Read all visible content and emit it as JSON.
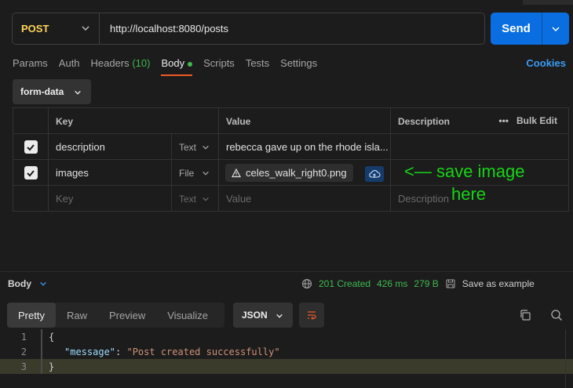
{
  "request": {
    "method": "POST",
    "url": "http://localhost:8080/posts",
    "send_label": "Send"
  },
  "tabs": [
    {
      "label": "Params"
    },
    {
      "label": "Auth"
    },
    {
      "label": "Headers",
      "count": "(10)"
    },
    {
      "label": "Body"
    },
    {
      "label": "Scripts"
    },
    {
      "label": "Tests"
    },
    {
      "label": "Settings"
    }
  ],
  "cookies_label": "Cookies",
  "body_type": "form-data",
  "table": {
    "headers": {
      "key": "Key",
      "value": "Value",
      "description": "Description",
      "bulk_edit": "Bulk Edit"
    },
    "rows": [
      {
        "key": "description",
        "type": "Text",
        "value": "rebecca gave up on the rhode isla...",
        "description": ""
      },
      {
        "key": "images",
        "type": "File",
        "value": "celes_walk_right0.png",
        "description": ""
      }
    ],
    "placeholder": {
      "key": "Key",
      "type": "Text",
      "value": "Value",
      "description": "Description"
    }
  },
  "annotation": {
    "line1": "<— save image",
    "line2": "here"
  },
  "response": {
    "label": "Body",
    "status": "201 Created",
    "time": "426 ms",
    "size": "279 B",
    "save_label": "Save as example",
    "tabs": [
      "Pretty",
      "Raw",
      "Preview",
      "Visualize"
    ],
    "format": "JSON",
    "lines": [
      {
        "num": "1",
        "text": "{"
      },
      {
        "num": "2",
        "key": "\"message\"",
        "sep": ": ",
        "value": "\"Post created successfully\""
      },
      {
        "num": "3",
        "text": "}"
      }
    ]
  },
  "colors": {
    "accent": "#0a6ee0",
    "method": "#ffd359",
    "success": "#3fb950",
    "annotation": "#17d417",
    "active_tab": "#ef5b25"
  }
}
